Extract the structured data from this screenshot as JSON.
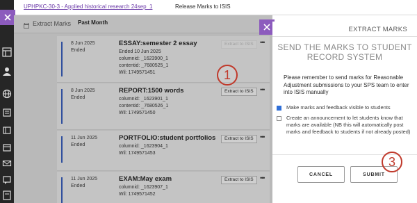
{
  "breadcrumb": {
    "course_link": "UPHPKC-30-3 - Applied historical research 24sep_1",
    "current": "Release Marks to ISIS"
  },
  "background_panel": {
    "title": "Extract Marks",
    "period_select": "Past Month",
    "rows": [
      {
        "date": "8 Jun 2025",
        "status": "Ended",
        "name": "ESSAY:semester 2 essay",
        "meta": [
          "Ended 10 Jun 2025",
          "columnid: _1623900_1",
          "contentid: _7680525_1",
          "Wil: 1749571451"
        ],
        "button": "Extract to ISIS",
        "button_enabled": false,
        "more": "•••"
      },
      {
        "date": "8 Jun 2025",
        "status": "Ended",
        "name": "REPORT:1500 words",
        "meta": [
          "columnid: _1623901_1",
          "contentid: _7680526_1",
          "Wil: 1749571450"
        ],
        "button": "Extract to ISIS",
        "button_enabled": true,
        "more": "•••"
      },
      {
        "date": "11 Jun 2025",
        "status": "Ended",
        "name": "PORTFOLIO:student portfolios",
        "meta": [
          "columnid: _1623904_1",
          "Wil: 1749571453"
        ],
        "button": "Extract to ISIS",
        "button_enabled": true,
        "more": "•••"
      },
      {
        "date": "11 Jun 2025",
        "status": "Ended",
        "name": "EXAM:May exam",
        "meta": [
          "columnid: _1623907_1",
          "Wil: 1749571452"
        ],
        "button": "Extract to ISIS",
        "button_enabled": true,
        "more": "•••"
      }
    ]
  },
  "modal": {
    "title": "EXTRACT MARKS",
    "heading": "SEND THE MARKS TO STUDENT RECORD SYSTEM",
    "description": "Please remember to send marks for Reasonable Adjustment submissions to your SPS team to enter into ISIS manually",
    "options": [
      {
        "label": "Make marks and feedback visible to students",
        "checked": true
      },
      {
        "label": "Create an announcement to let students know that marks are available (NB this will automatically post marks and feedback to students if not already posted)",
        "checked": false
      }
    ],
    "cancel_label": "CANCEL",
    "submit_label": "SUBMIT"
  },
  "annotations": [
    "1",
    "3"
  ],
  "colors": {
    "accent_purple": "#8c5bbd",
    "link_purple": "#6b3aa8",
    "row_accent": "#2f4f9e",
    "annotation_red": "#c0392b",
    "checkbox_blue": "#2f6fd8"
  }
}
